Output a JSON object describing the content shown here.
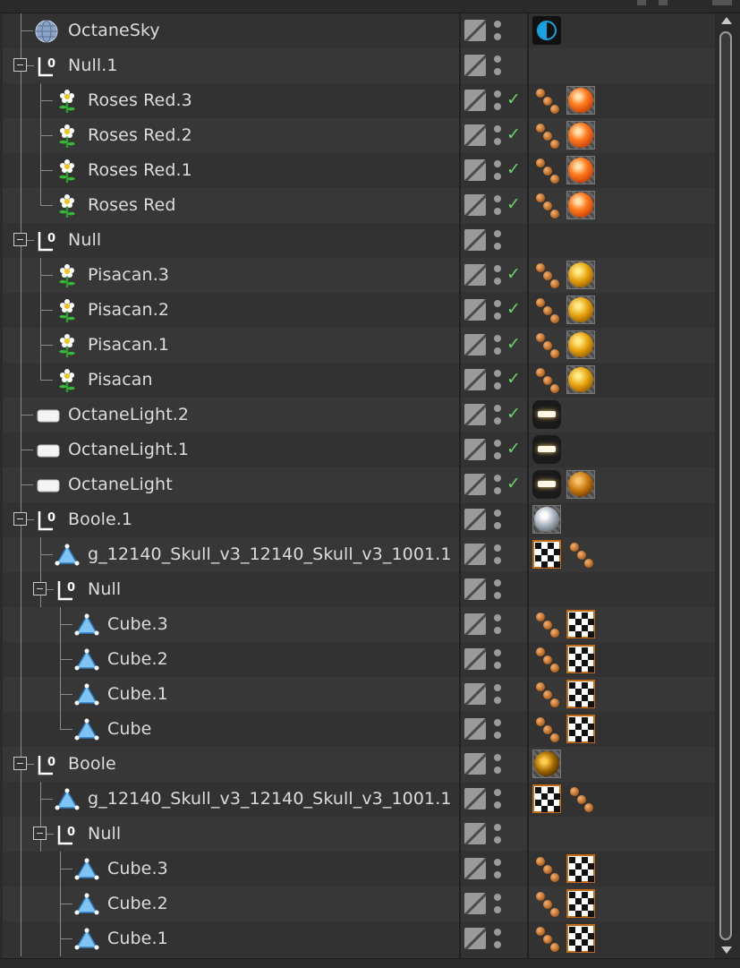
{
  "object_manager": {
    "rows": [
      {
        "label": "OctaneSky",
        "icon": "sky-sphere-icon",
        "tags": [
          "sky-tag"
        ],
        "check": false
      },
      {
        "label": "Null.1",
        "icon": "null-icon",
        "tags": [],
        "check": false
      },
      {
        "label": "Roses Red.3",
        "icon": "plant-icon",
        "tags": [
          "scatter-tag",
          "orange-material-tag"
        ],
        "check": true
      },
      {
        "label": "Roses Red.2",
        "icon": "plant-icon",
        "tags": [
          "scatter-tag",
          "orange-material-tag"
        ],
        "check": true
      },
      {
        "label": "Roses Red.1",
        "icon": "plant-icon",
        "tags": [
          "scatter-tag",
          "orange-material-tag"
        ],
        "check": true
      },
      {
        "label": "Roses Red",
        "icon": "plant-icon",
        "tags": [
          "scatter-tag",
          "orange-material-tag"
        ],
        "check": true
      },
      {
        "label": "Null",
        "icon": "null-icon",
        "tags": [],
        "check": false
      },
      {
        "label": "Pisacan.3",
        "icon": "plant-icon",
        "tags": [
          "scatter-tag",
          "gold-material-tag"
        ],
        "check": true
      },
      {
        "label": "Pisacan.2",
        "icon": "plant-icon",
        "tags": [
          "scatter-tag",
          "gold-material-tag"
        ],
        "check": true
      },
      {
        "label": "Pisacan.1",
        "icon": "plant-icon",
        "tags": [
          "scatter-tag",
          "gold-material-tag"
        ],
        "check": true
      },
      {
        "label": "Pisacan",
        "icon": "plant-icon",
        "tags": [
          "scatter-tag",
          "gold-material-tag"
        ],
        "check": true
      },
      {
        "label": "OctaneLight.2",
        "icon": "area-light-icon",
        "tags": [
          "light-tag"
        ],
        "check": true
      },
      {
        "label": "OctaneLight.1",
        "icon": "area-light-icon",
        "tags": [
          "light-tag"
        ],
        "check": true
      },
      {
        "label": "OctaneLight",
        "icon": "area-light-icon",
        "tags": [
          "light-tag",
          "amber-material-tag"
        ],
        "check": true
      },
      {
        "label": "Boole.1",
        "icon": "null-icon",
        "tags": [
          "metal-material-tag"
        ],
        "check": false
      },
      {
        "label": "g_12140_Skull_v3_12140_Skull_v3_1001.1",
        "icon": "mesh-icon",
        "tags": [
          "checker-texture-tag",
          "scatter-tag"
        ],
        "check": false
      },
      {
        "label": "Null",
        "icon": "null-icon",
        "tags": [],
        "check": false
      },
      {
        "label": "Cube.3",
        "icon": "mesh-icon",
        "tags": [
          "scatter-tag",
          "checker-texture-tag"
        ],
        "check": false
      },
      {
        "label": "Cube.2",
        "icon": "mesh-icon",
        "tags": [
          "scatter-tag",
          "checker-texture-tag"
        ],
        "check": false
      },
      {
        "label": "Cube.1",
        "icon": "mesh-icon",
        "tags": [
          "scatter-tag",
          "checker-texture-tag"
        ],
        "check": false
      },
      {
        "label": "Cube",
        "icon": "mesh-icon",
        "tags": [
          "scatter-tag",
          "checker-texture-tag"
        ],
        "check": false
      },
      {
        "label": "Boole",
        "icon": "null-icon",
        "tags": [
          "dark-gold-material-tag"
        ],
        "check": false
      },
      {
        "label": "g_12140_Skull_v3_12140_Skull_v3_1001.1",
        "icon": "mesh-icon",
        "tags": [
          "checker-texture-tag",
          "scatter-tag"
        ],
        "check": false
      },
      {
        "label": "Null",
        "icon": "null-icon",
        "tags": [],
        "check": false
      },
      {
        "label": "Cube.3",
        "icon": "mesh-icon",
        "tags": [
          "scatter-tag",
          "checker-texture-tag"
        ],
        "check": false
      },
      {
        "label": "Cube.2",
        "icon": "mesh-icon",
        "tags": [
          "scatter-tag",
          "checker-texture-tag"
        ],
        "check": false
      },
      {
        "label": "Cube.1",
        "icon": "mesh-icon",
        "tags": [
          "scatter-tag",
          "checker-texture-tag"
        ],
        "check": false
      }
    ]
  },
  "colors": {
    "background": "#333333",
    "text": "#dcdcdc",
    "check": "#6bd36b",
    "sky_accent": "#19a3e0",
    "checker_border": "#c26a14"
  }
}
